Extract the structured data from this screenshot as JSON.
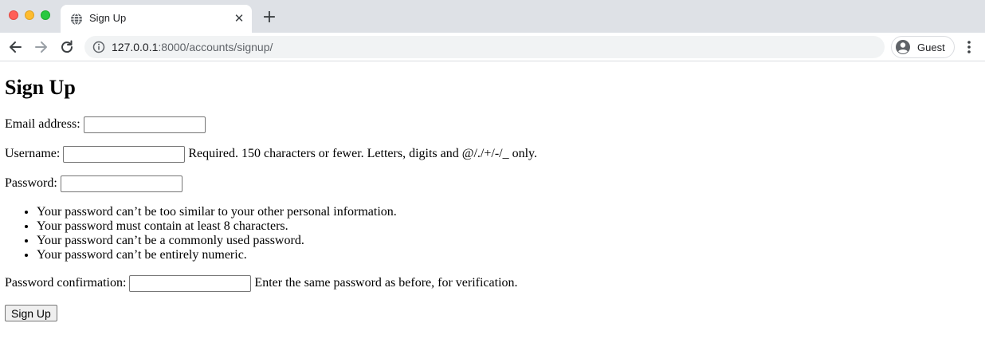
{
  "browser": {
    "tab_title": "Sign Up",
    "url_host": "127.0.0.1",
    "url_path": ":8000/accounts/signup/",
    "profile_label": "Guest"
  },
  "page": {
    "heading": "Sign Up",
    "email": {
      "label": "Email address:",
      "value": ""
    },
    "username": {
      "label": "Username:",
      "value": "",
      "help": "Required. 150 characters or fewer. Letters, digits and @/./+/-/_ only."
    },
    "password": {
      "label": "Password:",
      "value": ""
    },
    "password_rules": [
      "Your password can’t be too similar to your other personal information.",
      "Your password must contain at least 8 characters.",
      "Your password can’t be a commonly used password.",
      "Your password can’t be entirely numeric."
    ],
    "password_confirmation": {
      "label": "Password confirmation:",
      "value": "",
      "help": "Enter the same password as before, for verification."
    },
    "submit_label": "Sign Up"
  },
  "icons": {
    "tab_favicon": "globe-icon",
    "back": "back-arrow-icon",
    "forward": "forward-arrow-icon",
    "reload": "reload-icon",
    "site_info": "info-icon",
    "profile": "avatar-icon",
    "menu": "kebab-menu-icon"
  },
  "colors": {
    "tabbar": "#dee1e6",
    "omnibox": "#f1f3f4",
    "close": "#ff5f57",
    "minimize": "#febc2e",
    "maximize": "#28c840"
  }
}
